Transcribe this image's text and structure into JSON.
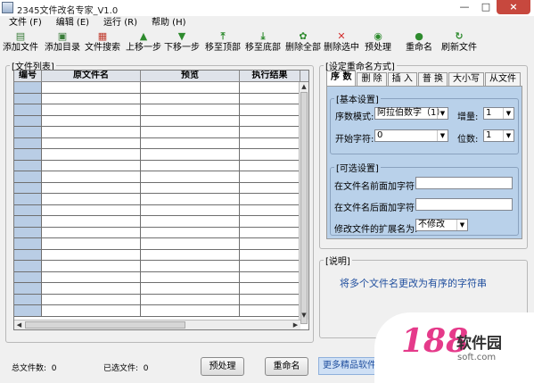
{
  "window": {
    "title": "2345文件改名专家_V1.0",
    "controls": [
      "—",
      "□",
      "×"
    ]
  },
  "menu": [
    "文件 (F)",
    "编辑 (E)",
    "运行 (R)",
    "帮助 (H)"
  ],
  "toolbar": [
    {
      "label": "添加文件",
      "icon": "add-file-icon",
      "glyph": "▤",
      "color": "#3a7d3a"
    },
    {
      "label": "添加目录",
      "icon": "add-folder-icon",
      "glyph": "▣",
      "color": "#3a7d3a"
    },
    {
      "label": "文件搜索",
      "icon": "search-file-icon",
      "glyph": "▦",
      "color": "#c0392b"
    },
    {
      "label": "上移一步",
      "icon": "arrow-up-icon",
      "glyph": "▲",
      "color": "#2e8b2e"
    },
    {
      "label": "下移一步",
      "icon": "arrow-down-icon",
      "glyph": "▼",
      "color": "#2e8b2e"
    },
    {
      "label": "移至顶部",
      "icon": "move-top-icon",
      "glyph": "⤒",
      "color": "#2e8b2e"
    },
    {
      "label": "移至底部",
      "icon": "move-bottom-icon",
      "glyph": "⤓",
      "color": "#2e8b2e"
    },
    {
      "label": "删除全部",
      "icon": "delete-all-icon",
      "glyph": "✿",
      "color": "#2e8b2e"
    },
    {
      "label": "删除选中",
      "icon": "delete-selected-icon",
      "glyph": "✕",
      "color": "#d32f2f"
    },
    {
      "label": "预处理",
      "icon": "preprocess-icon",
      "glyph": "◉",
      "color": "#2e8b2e"
    },
    {
      "label": "重命名",
      "icon": "rename-icon",
      "glyph": "●",
      "color": "#2e8b2e"
    },
    {
      "label": "刷新文件",
      "icon": "refresh-icon",
      "glyph": "↻",
      "color": "#2e8b2e"
    }
  ],
  "file_list": {
    "legend": "文件列表",
    "columns": [
      "编号",
      "原文件名",
      "预览",
      "执行结果"
    ]
  },
  "rename_panel": {
    "legend": "设定重命名方式",
    "tabs": [
      "序 数",
      "删 除",
      "插 入",
      "普 换",
      "大小写",
      "从文件"
    ],
    "basic": {
      "legend": "基本设置",
      "sequence_mode_label": "序数模式:",
      "sequence_mode_value": "阿拉伯数字（1）",
      "increment_label": "增量:",
      "increment_value": "1",
      "start_char_label": "开始字符:",
      "start_char_value": "0",
      "digits_label": "位数:",
      "digits_value": "1"
    },
    "optional": {
      "legend": "可选设置",
      "prefix_label": "在文件名前面加字符:",
      "prefix_value": "",
      "suffix_label": "在文件名后面加字符:",
      "suffix_value": "",
      "ext_label": "修改文件的扩展名为:",
      "ext_value": "不修改"
    }
  },
  "description": {
    "legend": "说明",
    "text": "将多个文件名更改为有序的字符串"
  },
  "status": {
    "total_label": "总文件数:",
    "total_value": "0",
    "selected_label": "已选文件:",
    "selected_value": "0"
  },
  "buttons": {
    "preprocess": "预处理",
    "rename": "重命名",
    "more": "更多精品软件"
  },
  "watermark": {
    "number": "188",
    "brand": "软件园",
    "url": "soft.com"
  }
}
